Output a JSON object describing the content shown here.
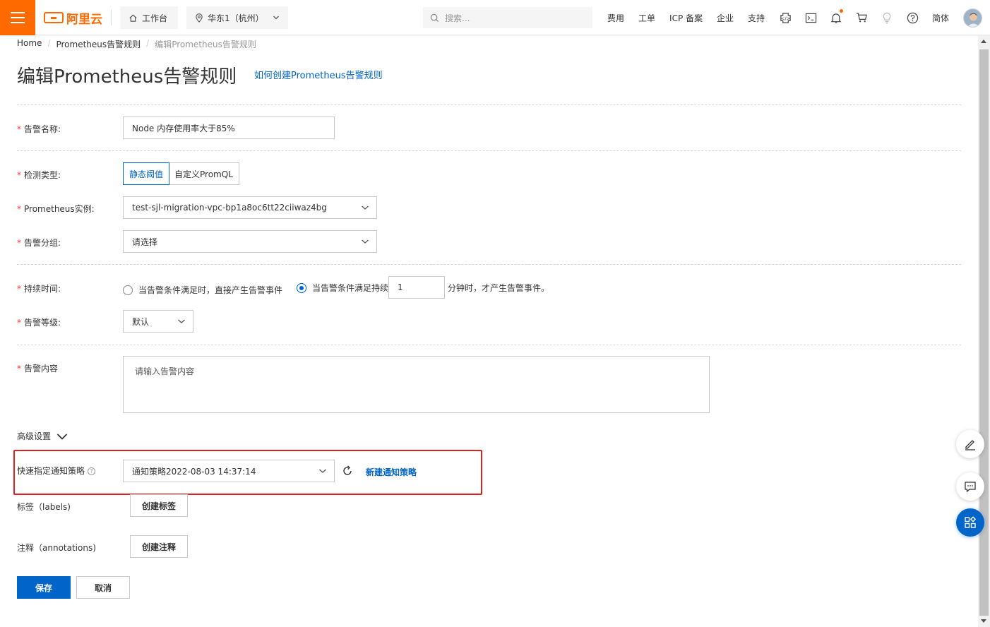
{
  "topbar": {
    "logo_text": "阿里云",
    "workbench": "工作台",
    "region": "华东1（杭州）",
    "search_placeholder": "搜索...",
    "links": [
      "费用",
      "工单",
      "ICP 备案",
      "企业",
      "支持"
    ],
    "lang": "简体",
    "accent_color": "#ff6a00"
  },
  "breadcrumb": {
    "items": [
      "Home",
      "Prometheus告警规则",
      "编辑Prometheus告警规则"
    ]
  },
  "page": {
    "title": "编辑Prometheus告警规则",
    "help_link": "如何创建Prometheus告警规则"
  },
  "form": {
    "alert_name": {
      "label": "告警名称:",
      "value": "Node 内存使用率大于85%"
    },
    "detect_type": {
      "label": "检测类型:",
      "options": [
        "静态阈值",
        "自定义PromQL"
      ],
      "selected": "静态阈值"
    },
    "instance": {
      "label": "Prometheus实例:",
      "value": "test-sjl-migration-vpc-bp1a8oc6tt22ciiwaz4bg"
    },
    "group": {
      "label": "告警分组:",
      "value": "请选择"
    },
    "duration": {
      "label": "持续时间:",
      "option1": "当告警条件满足时，直接产生告警事件",
      "option2_prefix": "当告警条件满足持续",
      "option2_value": "1",
      "option2_suffix": "分钟时，才产生告警事件。",
      "selected": "option2"
    },
    "level": {
      "label": "告警等级:",
      "value": "默认"
    },
    "content": {
      "label": "告警内容",
      "placeholder": "请输入告警内容"
    },
    "advanced": {
      "label": "高级设置"
    },
    "notify_policy": {
      "label": "快速指定通知策略",
      "value": "通知策略2022-08-03 14:37:14",
      "new_link": "新建通知策略"
    },
    "labels": {
      "label": "标签（labels)",
      "button": "创建标签"
    },
    "annotations": {
      "label": "注释（annotations)",
      "button": "创建注释"
    }
  },
  "actions": {
    "save": "保存",
    "cancel": "取消",
    "primary_color": "#0064c8"
  },
  "required_mark": "*",
  "help_icon_glyph": "?"
}
